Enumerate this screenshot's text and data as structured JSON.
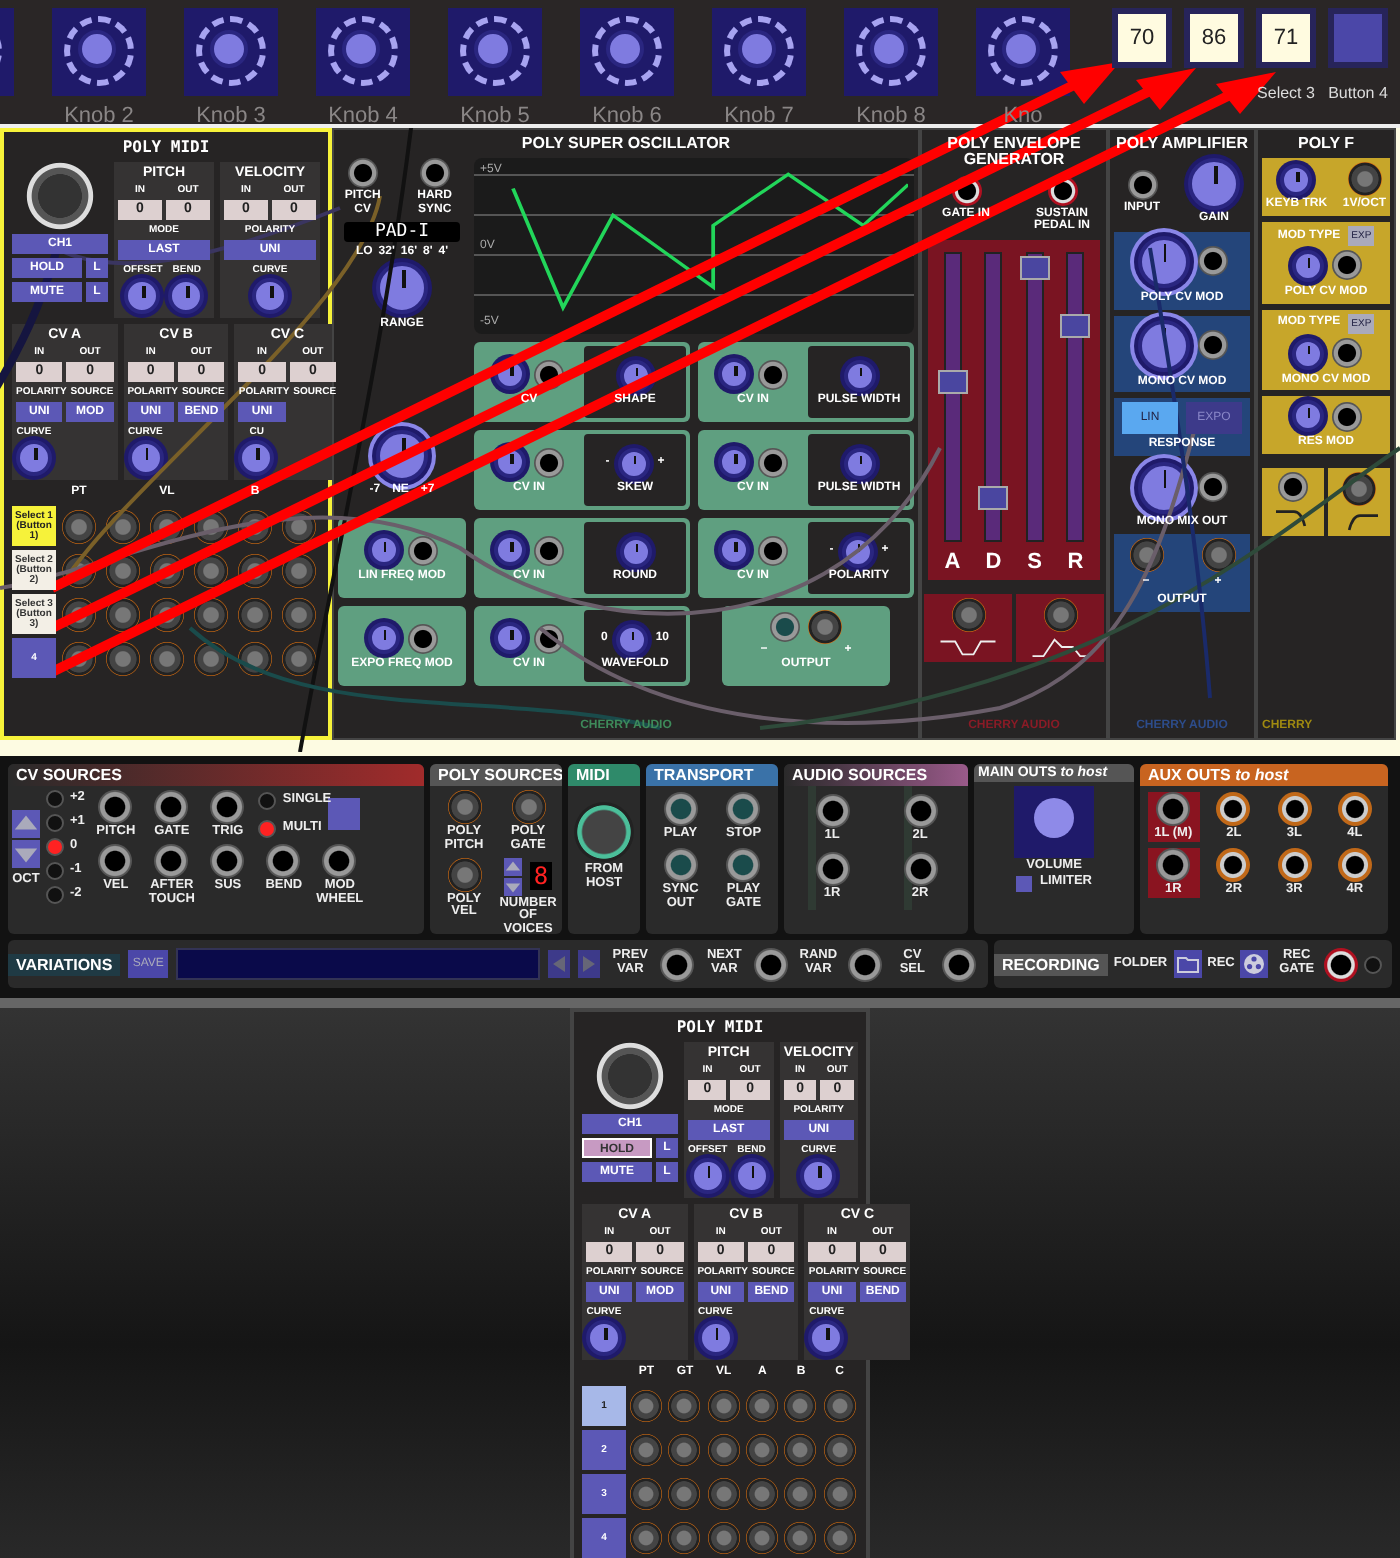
{
  "knob_bar": {
    "knobs": [
      "Knob 2",
      "Knob 3",
      "Knob 4",
      "Knob 5",
      "Knob 6",
      "Knob 7",
      "Knob 8",
      "Kno"
    ],
    "buttons": [
      {
        "value": "70"
      },
      {
        "value": "86"
      },
      {
        "value": "71",
        "label": "Select 3"
      },
      {
        "label": "Button 4"
      }
    ]
  },
  "rack": {
    "poly_midi": {
      "title": "POLY MIDI",
      "selected": true,
      "channel": "CH1",
      "hold": {
        "label": "HOLD",
        "on": false
      },
      "hold_lock": "L",
      "mute": {
        "label": "MUTE",
        "on": false
      },
      "mute_lock": "L",
      "pitch": {
        "title": "PITCH",
        "in_label": "IN",
        "out_label": "OUT",
        "in": "0",
        "out": "0",
        "option_label": "MODE",
        "option": "LAST",
        "knobs": [
          "OFFSET",
          "BEND"
        ]
      },
      "velocity": {
        "title": "VELOCITY",
        "in_label": "IN",
        "out_label": "OUT",
        "in": "0",
        "out": "0",
        "option_label": "POLARITY",
        "option": "UNI",
        "knobs": [
          "CURVE"
        ]
      },
      "cv": [
        {
          "title": "CV A",
          "in_label": "IN",
          "out_label": "OUT",
          "in": "0",
          "out": "0",
          "polarity_label": "POLARITY",
          "polarity": "UNI",
          "source_label": "SOURCE",
          "source": "MOD",
          "curve_label": "CURVE"
        },
        {
          "title": "CV B",
          "in_label": "IN",
          "out_label": "OUT",
          "in": "0",
          "out": "0",
          "polarity_label": "POLARITY",
          "polarity": "UNI",
          "source_label": "SOURCE",
          "source": "BEND",
          "curve_label": "CURVE"
        },
        {
          "title": "CV C",
          "in_label": "IN",
          "out_label": "OUT",
          "in": "0",
          "out": "0",
          "polarity_label": "POLARITY",
          "polarity": "UNI",
          "source_label": "SOURCE",
          "curve_label": "CU"
        }
      ],
      "columns": [
        {
          "label": "PT"
        },
        {},
        {
          "label": "VL"
        },
        {},
        {
          "label": "B"
        },
        {}
      ],
      "rows": [
        {
          "label": "Select 1 (Button 1)",
          "selected": true,
          "mapped": true
        },
        {
          "label": "Select 2 (Button 2)",
          "selected": false,
          "mapped": true
        },
        {
          "label": "Select 3 (Button 3)",
          "selected": false,
          "mapped": true
        },
        {
          "label": "4",
          "selected": false,
          "mapped": false
        }
      ]
    },
    "oscillator": {
      "title": "POLY SUPER OSCILLATOR",
      "jacks": [
        "PITCH CV",
        "HARD SYNC"
      ],
      "preset": "PAD-I",
      "range_marks": [
        "LO",
        "32'",
        "16'",
        "8'",
        "4'"
      ],
      "range_label": "RANGE",
      "tune": {
        "min": "-7",
        "max": "+7",
        "label": "NE"
      },
      "scope_labels": [
        "+5V",
        "0V",
        "-5V"
      ],
      "rows": [
        [
          {
            "jack_label": "CV",
            "control": "SHAPE"
          },
          {
            "jack_label": "CV IN",
            "control": "PULSE WIDTH"
          }
        ],
        [
          {
            "jack_label": "CV IN",
            "control": "SKEW",
            "min": "-",
            "max": "+"
          },
          {
            "jack_label": "CV IN",
            "control": "PULSE WIDTH"
          }
        ],
        [
          {
            "jack_label": "CV IN",
            "control": "ROUND"
          },
          {
            "jack_label": "CV IN",
            "control": "POLARITY",
            "min": "-",
            "max": "+"
          }
        ],
        [
          {
            "jack_label": "CV IN",
            "control": "WAVEFOLD",
            "min": "0",
            "max": "10"
          }
        ]
      ],
      "side_inputs": [
        "LIN FREQ MOD",
        "EXPO FREQ MOD"
      ],
      "output": {
        "label": "OUTPUT",
        "minus": "−",
        "plus": "+"
      },
      "brand": "CHERRY AUDIO"
    },
    "envelope": {
      "title": "POLY ENVELOPE GENERATOR",
      "inputs": [
        "GATE IN",
        "SUSTAIN PEDAL IN"
      ],
      "sliders": [
        {
          "label": "A",
          "level": 0.55
        },
        {
          "label": "D",
          "level": 0.15
        },
        {
          "label": "S",
          "level": 0.95
        },
        {
          "label": "R",
          "level": 0.75
        }
      ],
      "brand": "CHERRY AUDIO"
    },
    "amplifier": {
      "title": "POLY AMPLIFIER",
      "input": "INPUT",
      "gain": "GAIN",
      "mods": [
        "POLY CV MOD",
        "MONO CV MOD"
      ],
      "response": {
        "label": "RESPONSE",
        "options": [
          {
            "label": "LIN",
            "selected": true
          },
          {
            "label": "EXPO",
            "selected": false
          }
        ]
      },
      "mix_out": "MONO MIX OUT",
      "output": {
        "label": "OUTPUT",
        "minus": "−",
        "plus": "+"
      },
      "brand": "CHERRY AUDIO"
    },
    "filter": {
      "title": "POLY F",
      "cells": [
        {
          "kind": "pair",
          "knob": "KEYB TRK",
          "jack": "1V/OCT"
        },
        {
          "kind": "mod",
          "type_label": "MOD TYPE",
          "type": "EXP",
          "label": "POLY CV MOD"
        },
        {
          "kind": "mod",
          "type_label": "MOD TYPE",
          "type": "EXP",
          "label": "MONO CV MOD"
        },
        {
          "kind": "single",
          "label": "RES MOD"
        }
      ],
      "brand": "CHERRY"
    }
  },
  "host": {
    "cv_sources": {
      "title": "CV SOURCES",
      "octaves": [
        {
          "label": "+2",
          "selected": false
        },
        {
          "label": "+1",
          "selected": false
        },
        {
          "label": "0",
          "selected": true
        },
        {
          "label": "-1",
          "selected": false
        },
        {
          "label": "-2",
          "selected": false
        }
      ],
      "oct_label": "OCT",
      "jacks_top": [
        "PITCH",
        "GATE",
        "TRIG"
      ],
      "trigger_modes": [
        {
          "label": "SINGLE",
          "selected": false
        },
        {
          "label": "MULTI",
          "selected": true
        }
      ],
      "jacks_bottom": [
        "VEL",
        "AFTER TOUCH",
        "SUS",
        "BEND",
        "MOD WHEEL"
      ]
    },
    "poly_sources": {
      "title": "POLY SOURCES",
      "jacks": [
        "POLY PITCH",
        "POLY GATE",
        "POLY VEL"
      ],
      "voices_label": "NUMBER OF VOICES",
      "voices": "8"
    },
    "midi": {
      "title": "MIDI",
      "label": "FROM HOST"
    },
    "transport": {
      "title": "TRANSPORT",
      "jacks": [
        "PLAY",
        "STOP",
        "SYNC OUT",
        "PLAY GATE"
      ]
    },
    "audio_sources": {
      "title": "AUDIO SOURCES",
      "jacks": [
        "1L",
        "2L",
        "1R",
        "2R"
      ]
    },
    "main_outs": {
      "title": "MAIN OUTS *to host*",
      "volume": "VOLUME",
      "limiter": "LIMITER",
      "limiter_on": false
    },
    "aux_outs": {
      "title": "AUX OUTS *to host*",
      "jacks": [
        {
          "label": "1L (M)",
          "kind": "main"
        },
        {
          "label": "2L",
          "kind": "aux"
        },
        {
          "label": "3L",
          "kind": "aux"
        },
        {
          "label": "4L",
          "kind": "aux"
        },
        {
          "label": "1R",
          "kind": "main"
        },
        {
          "label": "2R",
          "kind": "aux"
        },
        {
          "label": "3R",
          "kind": "aux"
        },
        {
          "label": "4R",
          "kind": "aux"
        }
      ]
    },
    "variations": {
      "title": "VARIATIONS",
      "save": "SAVE",
      "controls": [
        "PREV VAR",
        "NEXT VAR",
        "RAND VAR",
        "CV SEL"
      ]
    },
    "recording": {
      "title": "RECORDING",
      "folder": "FOLDER",
      "rec": "REC",
      "rec_gate": "REC GATE"
    }
  },
  "lower_rack": {
    "poly_midi": {
      "title": "POLY MIDI",
      "selected": false,
      "channel": "CH1",
      "hold": {
        "label": "HOLD",
        "on": true
      },
      "hold_lock": "L",
      "mute": {
        "label": "MUTE",
        "on": false
      },
      "mute_lock": "L",
      "pitch": {
        "title": "PITCH",
        "in_label": "IN",
        "out_label": "OUT",
        "in": "0",
        "out": "0",
        "option_label": "MODE",
        "option": "LAST",
        "knobs": [
          "OFFSET",
          "BEND"
        ]
      },
      "velocity": {
        "title": "VELOCITY",
        "in_label": "IN",
        "out_label": "OUT",
        "in": "0",
        "out": "0",
        "option_label": "POLARITY",
        "option": "UNI",
        "knobs": [
          "CURVE"
        ]
      },
      "cv": [
        {
          "title": "CV A",
          "in_label": "IN",
          "out_label": "OUT",
          "in": "0",
          "out": "0",
          "polarity_label": "POLARITY",
          "polarity": "UNI",
          "source_label": "SOURCE",
          "source": "MOD",
          "curve_label": "CURVE"
        },
        {
          "title": "CV B",
          "in_label": "IN",
          "out_label": "OUT",
          "in": "0",
          "out": "0",
          "polarity_label": "POLARITY",
          "polarity": "UNI",
          "source_label": "SOURCE",
          "source": "BEND",
          "curve_label": "CURVE"
        },
        {
          "title": "CV C",
          "in_label": "IN",
          "out_label": "OUT",
          "in": "0",
          "out": "0",
          "polarity_label": "POLARITY",
          "polarity": "UNI",
          "source_label": "SOURCE",
          "source": "BEND",
          "curve_label": "CURVE"
        }
      ],
      "columns": [
        {
          "label": "PT"
        },
        {
          "label": "GT"
        },
        {
          "label": "VL"
        },
        {
          "label": "A"
        },
        {
          "label": "B"
        },
        {
          "label": "C"
        }
      ],
      "rows": [
        {
          "label": "1",
          "selected": true,
          "mapped": false
        },
        {
          "label": "2",
          "selected": false,
          "mapped": false
        },
        {
          "label": "3",
          "selected": false,
          "mapped": false
        },
        {
          "label": "4",
          "selected": false,
          "mapped": false
        }
      ]
    }
  }
}
